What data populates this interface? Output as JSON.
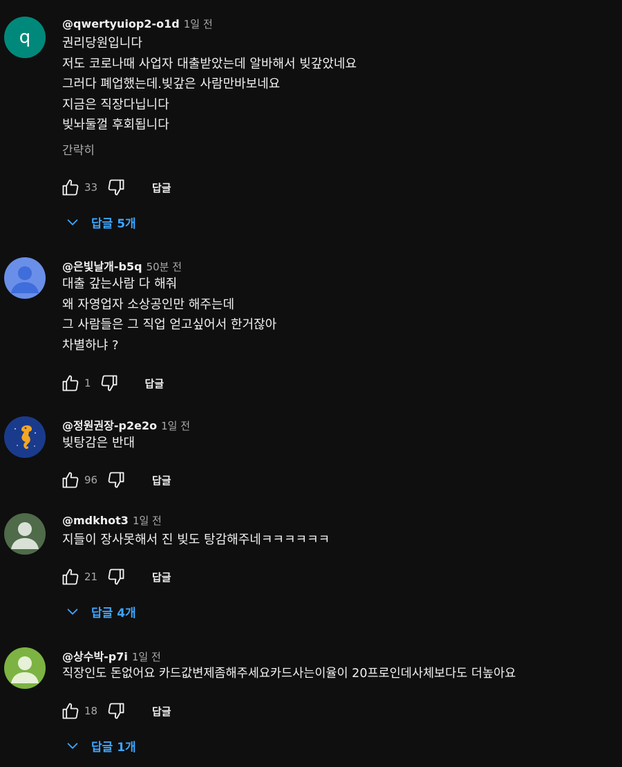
{
  "reply_button_label": "답글",
  "comments": [
    {
      "avatar": {
        "type": "letter",
        "letter": "q",
        "color": "#00897b"
      },
      "author": "@qwertyuiop2-o1d",
      "time": "1일 전",
      "lines": [
        "권리당원입니다",
        "저도 코로나때 사업자 대출받았는데 알바해서 빚갚았네요",
        "그러다 폐업했는데.빚갚은 사람만바보네요",
        "지금은 직장다닙니다",
        "빚놔둘껄 후회됩니다"
      ],
      "read_more": "간략히",
      "likes": "33",
      "replies": "답글 5개"
    },
    {
      "avatar": {
        "type": "default",
        "color": "#6a8fe8"
      },
      "author": "@은빛날개-b5q",
      "time": "50분 전",
      "lines": [
        "대출 갚는사람 다 해줘",
        "왜 자영업자 소상공인만 해주는데",
        "그 사람들은 그 직업 얻고싶어서 한거잖아",
        "차별하냐 ?"
      ],
      "likes": "1"
    },
    {
      "avatar": {
        "type": "seahorse",
        "color": "#1a3b8c"
      },
      "author": "@정원권장-p2e2o",
      "time": "1일 전",
      "lines": [
        "빚탕감은 반대"
      ],
      "likes": "96"
    },
    {
      "avatar": {
        "type": "default",
        "color": "#4f6b4a"
      },
      "author": "@mdkhot3",
      "time": "1일 전",
      "lines": [
        "지들이 장사못해서 진 빚도 탕감해주네ㅋㅋㅋㅋㅋㅋ"
      ],
      "likes": "21",
      "replies": "답글 4개"
    },
    {
      "avatar": {
        "type": "default",
        "color": "#7cb342"
      },
      "author": "@상수박-p7i",
      "time": "1일 전",
      "lines": [
        "직장인도 돈없어요 카드값변제좀해주세요카드사는이율이 20프로인데사체보다도 더높아요"
      ],
      "likes": "18",
      "replies": "답글 1개"
    }
  ]
}
